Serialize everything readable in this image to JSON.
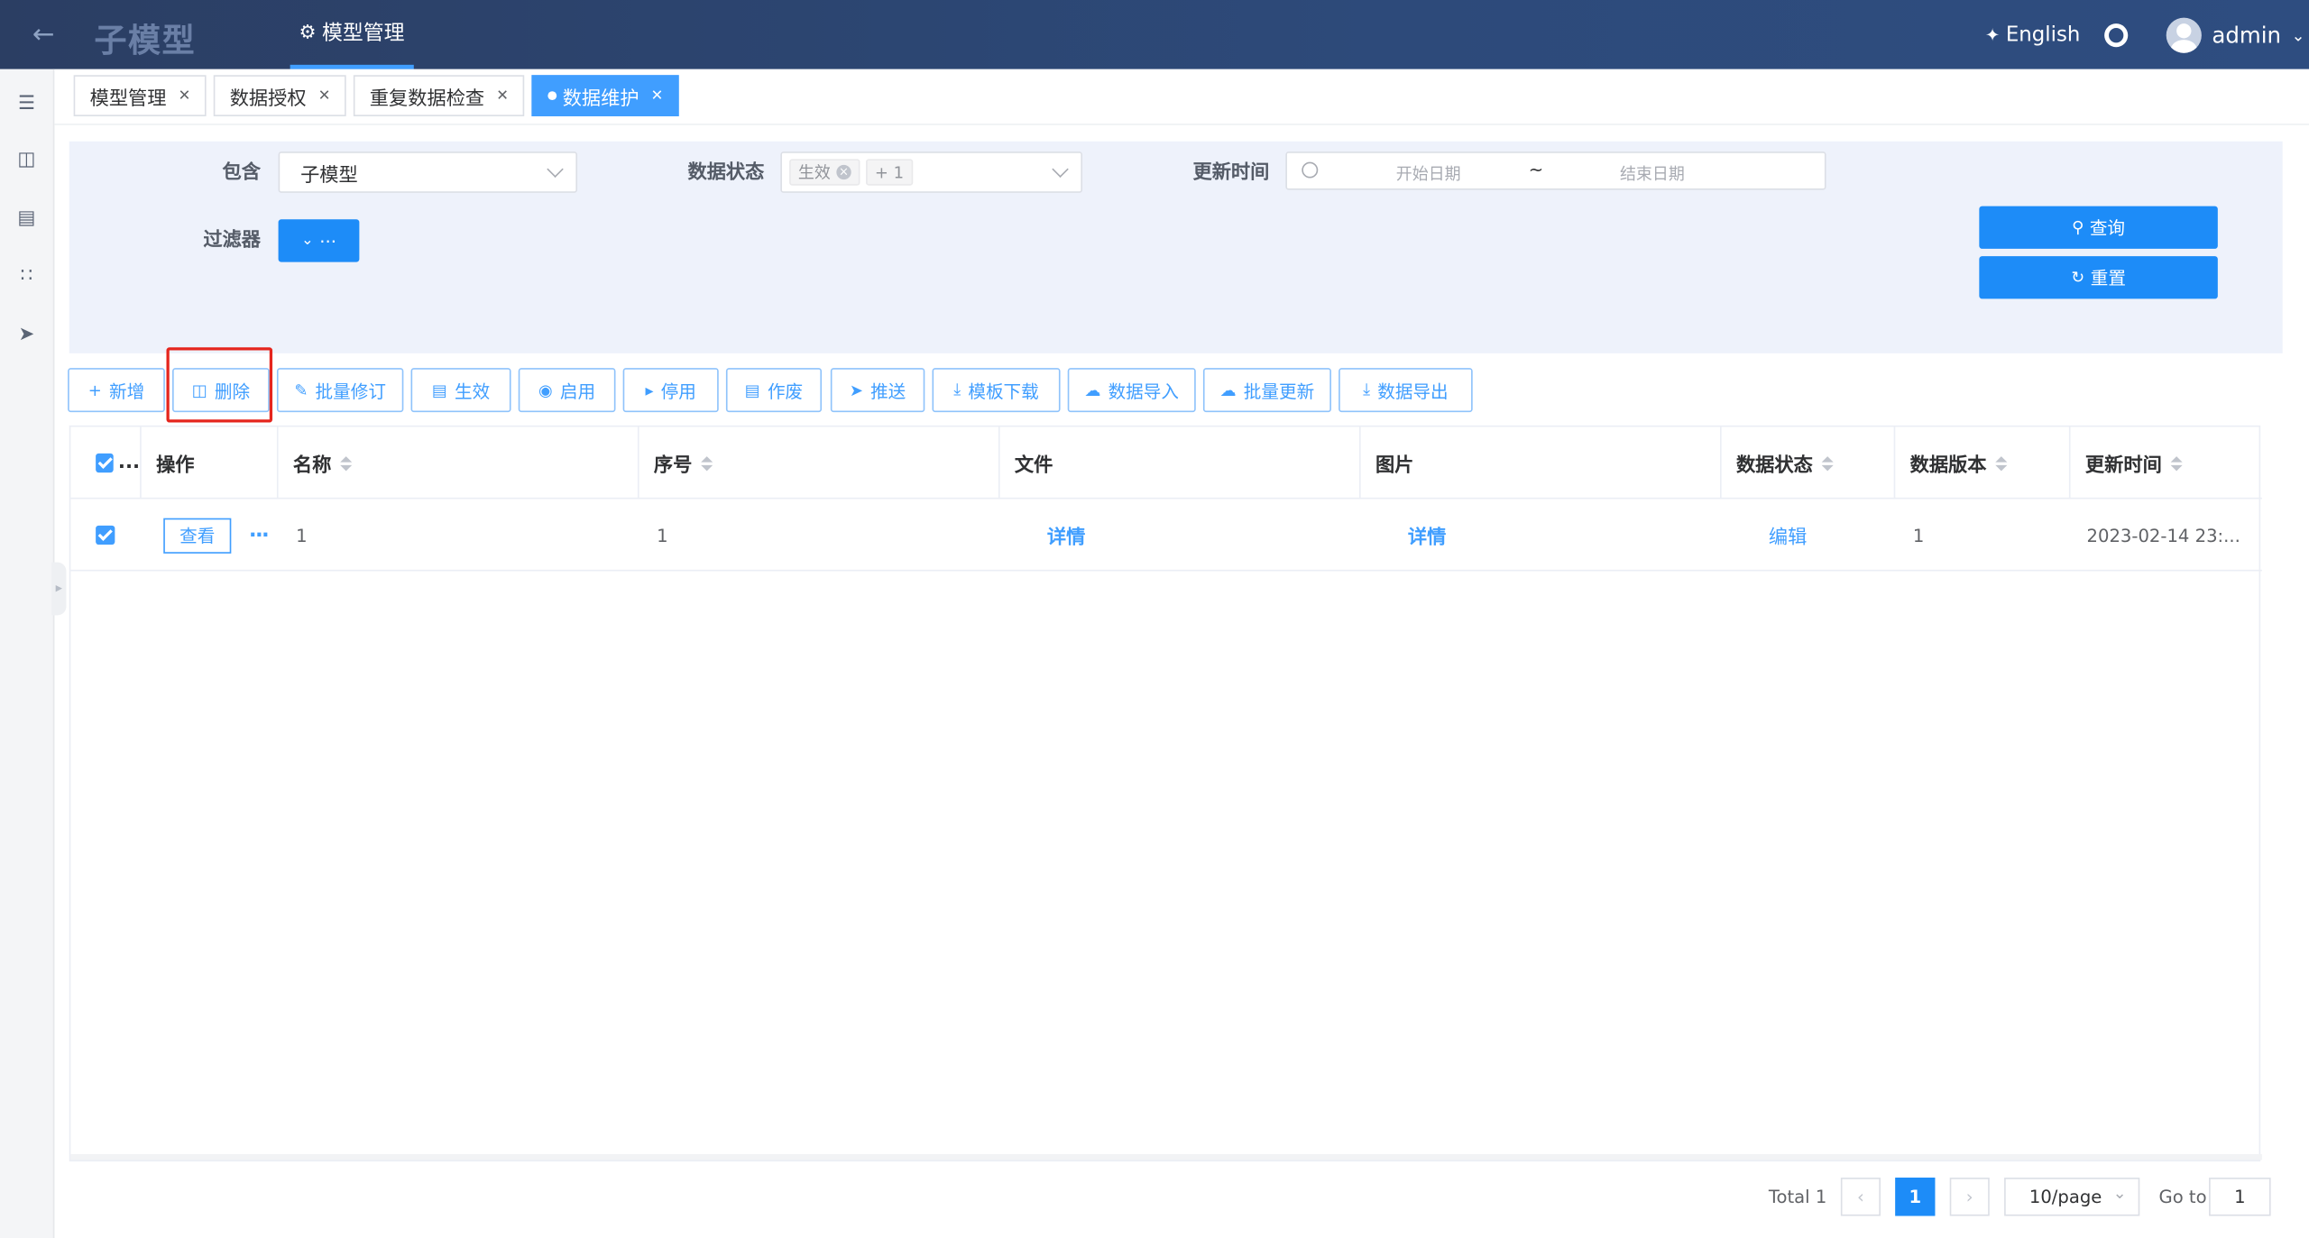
{
  "header": {
    "back_icon": "arrow-left-icon",
    "title": "子模型",
    "nav_tab": "模型管理",
    "language": "English",
    "user": "admin"
  },
  "tabs": [
    {
      "label": "模型管理",
      "active": false
    },
    {
      "label": "数据授权",
      "active": false
    },
    {
      "label": "重复数据检查",
      "active": false
    },
    {
      "label": "数据维护",
      "active": true
    }
  ],
  "filter": {
    "contain_label": "包含",
    "contain_value": "子模型",
    "status_label": "数据状态",
    "status_tag": "生效",
    "status_more": "+ 1",
    "update_label": "更新时间",
    "date_start_placeholder": "开始日期",
    "date_separator": "~",
    "date_end_placeholder": "结束日期",
    "filter_label": "过滤器",
    "filter_button": "···",
    "query_button": "查询",
    "reset_button": "重置"
  },
  "toolbar": {
    "add": "新增",
    "delete": "删除",
    "batch_revise": "批量修订",
    "effective": "生效",
    "enable": "启用",
    "disable": "停用",
    "void": "作废",
    "push": "推送",
    "template_download": "模板下载",
    "data_import": "数据导入",
    "batch_update": "批量更新",
    "data_export": "数据导出"
  },
  "table": {
    "headers": {
      "select": "...",
      "action": "操作",
      "name": "名称",
      "seq": "序号",
      "file": "文件",
      "image": "图片",
      "status": "数据状态",
      "version": "数据版本",
      "updated": "更新时间"
    },
    "rows": [
      {
        "view": "查看",
        "more": "···",
        "name": "1",
        "seq": "1",
        "file": "详情",
        "image": "详情",
        "status": "编辑",
        "version": "1",
        "updated": "2023-02-14 23:..."
      }
    ]
  },
  "pagination": {
    "total": "Total 1",
    "current_page": "1",
    "page_size": "10/page",
    "goto_label": "Go to",
    "goto_value": "1"
  },
  "colors": {
    "header_bg": "#2d4a7a",
    "primary": "#409eff",
    "filter_bg": "#eef2fb",
    "highlight": "#e5251d"
  }
}
